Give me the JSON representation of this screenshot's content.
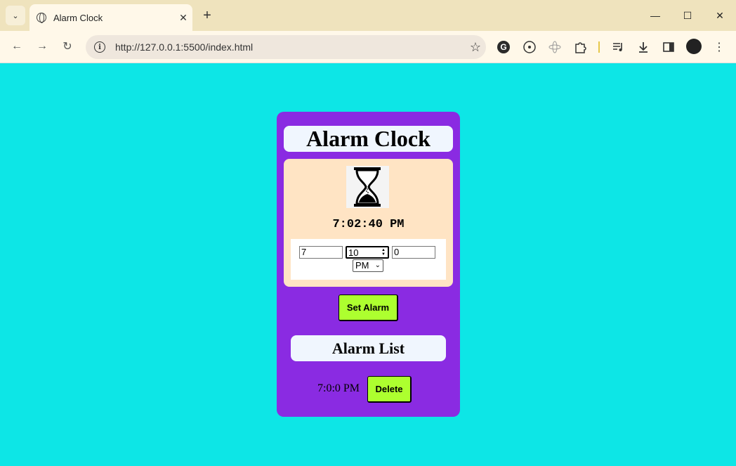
{
  "browser": {
    "tab_title": "Alarm Clock",
    "tab_close": "✕",
    "new_tab": "+",
    "url": "http://127.0.0.1:5500/index.html",
    "window_controls": [
      "—",
      "☐",
      "✕"
    ]
  },
  "app": {
    "title": "Alarm Clock",
    "current_time": "7:02:40 PM",
    "inputs": {
      "hour": "7",
      "minute": "10",
      "second": "0",
      "ampm": "PM"
    },
    "set_alarm_label": "Set Alarm",
    "alarm_list_title": "Alarm List",
    "alarms": [
      {
        "time": "7:0:0 PM",
        "delete_label": "Delete"
      }
    ]
  },
  "colors": {
    "page_bg": "#0de6e6",
    "app_bg": "#8a2be2",
    "panel_bg": "#ffe4c4",
    "button_bg": "#adff2f"
  }
}
